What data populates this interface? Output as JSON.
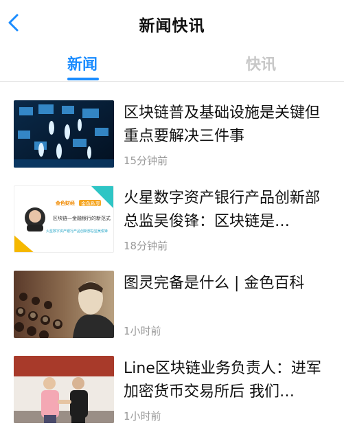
{
  "header": {
    "title": "新闻快讯"
  },
  "tabs": [
    {
      "label": "新闻"
    },
    {
      "label": "快讯"
    }
  ],
  "items": [
    {
      "title": "区块链普及基础设施是关键但重点要解决三件事",
      "time": "15分钟前",
      "thumbnail": "digital-human-figures-network"
    },
    {
      "title": "火星数字资产银行产品创新部总监吴俊锋：区块链是…",
      "time": "18分钟前",
      "thumbnail": "speaker-portrait-card",
      "thumb_text": {
        "brand": "金色财经",
        "tag": "金色私享",
        "line1": "区块链—金融银行的新范式",
        "line2": "火星数字资产银行产品创新部总监吴俊锋"
      }
    },
    {
      "title": "图灵完备是什么 | 金色百科",
      "time": "1小时前",
      "thumbnail": "turing-portrait-with-keyboard"
    },
    {
      "title": "Line区块链业务负责人：进军加密货币交易所后 我们…",
      "time": "1小时前",
      "thumbnail": "two-people-handshake"
    }
  ]
}
